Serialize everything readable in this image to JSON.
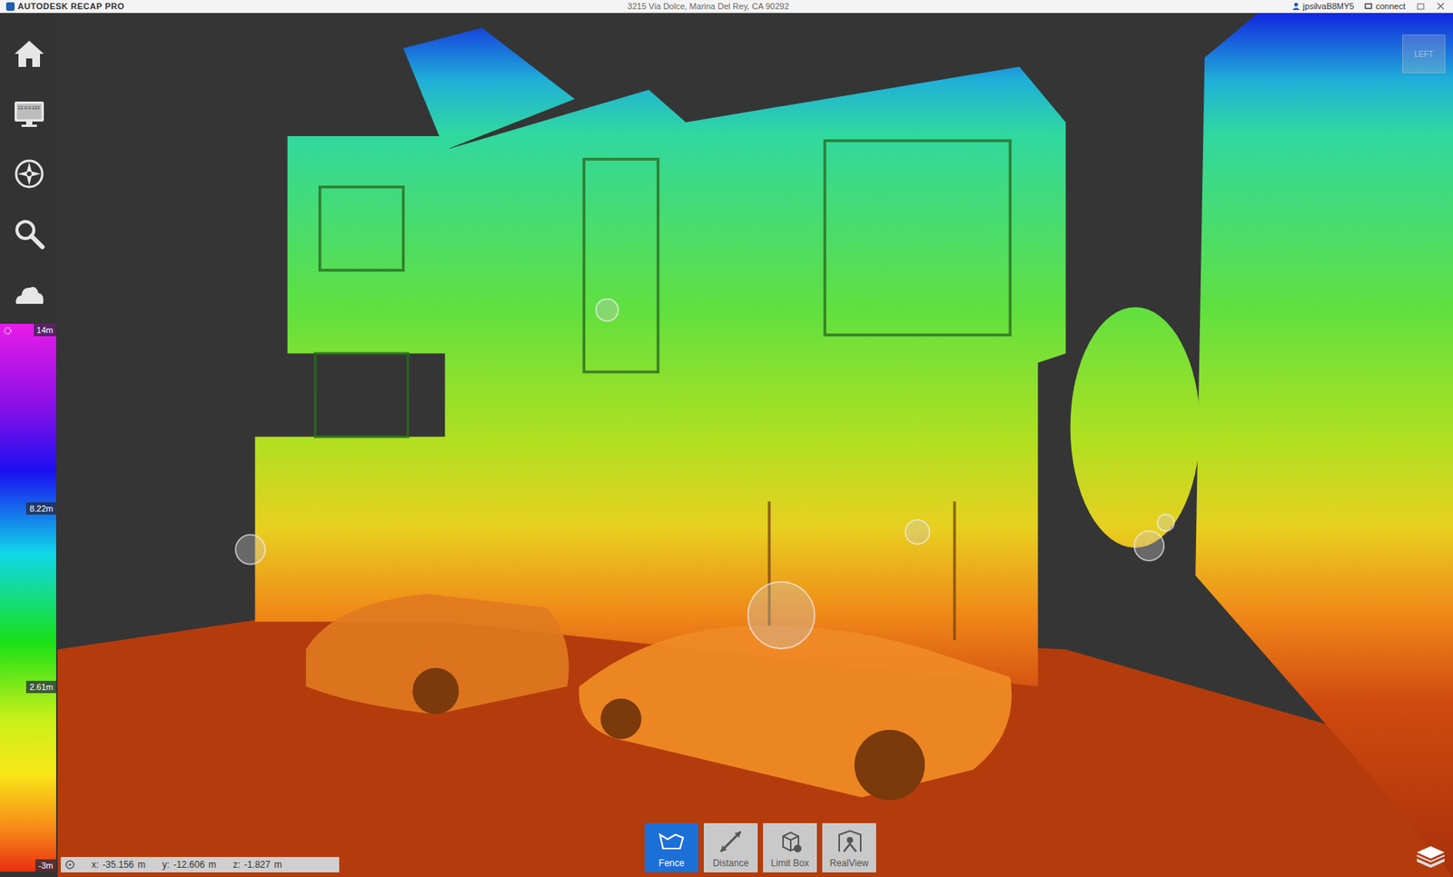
{
  "window": {
    "title": "AUTODESK RECAP PRO",
    "project": "3215 Via Dolce, Marina Del Rey, CA 90292",
    "user": "jpsilvaB8MY5",
    "connect": "connect"
  },
  "sidebar": {
    "display_badge": "22.0.0.223"
  },
  "legend": {
    "labels": [
      "14m",
      "8.22m",
      "2.61m",
      "-3m"
    ]
  },
  "view_cube": {
    "label": "LEFT"
  },
  "coordinates": [
    {
      "label": "x:",
      "value": "-35.156",
      "unit": "m"
    },
    {
      "label": "y:",
      "value": "-12.606",
      "unit": "m"
    },
    {
      "label": "z:",
      "value": "-1.827",
      "unit": "m"
    }
  ],
  "toolbar": [
    {
      "label": "Fence",
      "selected": true
    },
    {
      "label": "Distance",
      "selected": false
    },
    {
      "label": "Limit Box",
      "selected": false
    },
    {
      "label": "RealView",
      "selected": false
    }
  ]
}
